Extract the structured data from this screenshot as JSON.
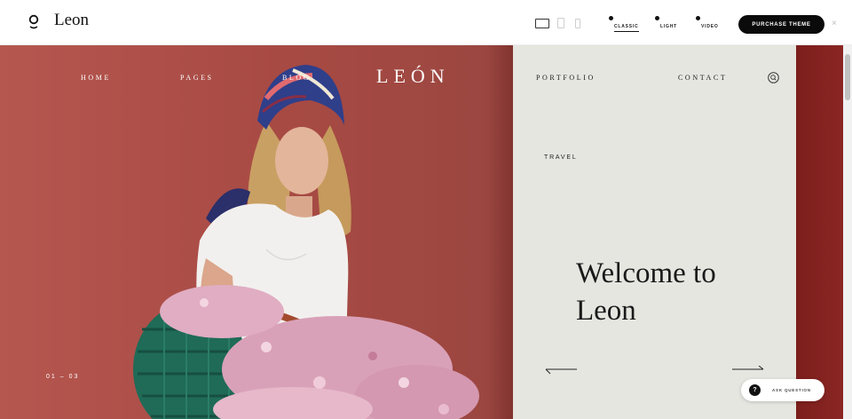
{
  "topbar": {
    "brand_name": "Leon",
    "devices": [
      "desktop-icon",
      "tablet-icon",
      "mobile-icon"
    ],
    "variants": [
      {
        "label": "CLASSIC",
        "active": true
      },
      {
        "label": "LIGHT",
        "active": false
      },
      {
        "label": "VIDEO",
        "active": false
      }
    ],
    "purchase_label": "PURCHASE THEME",
    "close_label": "×"
  },
  "nav": {
    "left": [
      "HOME",
      "PAGES",
      "BLOG"
    ],
    "logo": "LEÓN",
    "right": [
      "PORTFOLIO",
      "CONTACT"
    ],
    "search_icon": "search-icon"
  },
  "slide": {
    "category": "TRAVEL",
    "title_line1": "Welcome to",
    "title_line2": "Leon",
    "counter": "01 – 03",
    "prev_icon": "arrow-left-icon",
    "next_icon": "arrow-right-icon"
  },
  "help": {
    "icon": "question-icon",
    "q_mark": "?",
    "label": "ASK QUESTION"
  },
  "colors": {
    "hero_wall": "#a84a44",
    "panel": "#e6e6e1",
    "dark_strip": "#7c1f1c",
    "button_dark": "#0b0b0b"
  }
}
